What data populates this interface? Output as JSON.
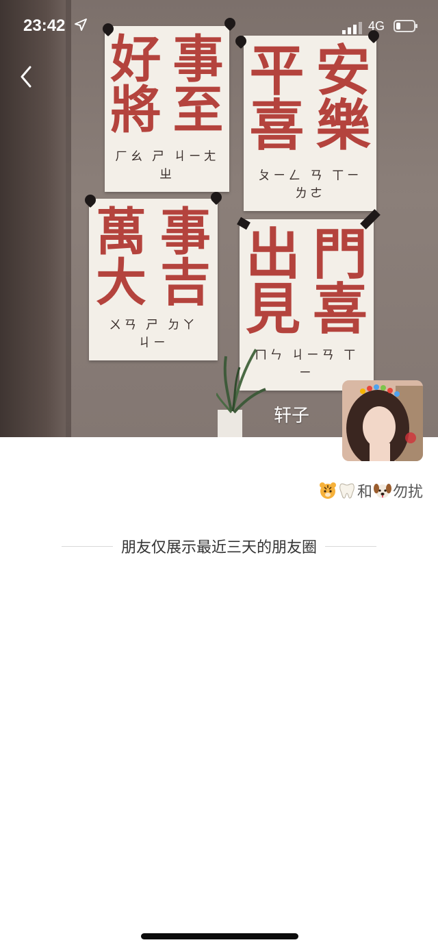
{
  "status_bar": {
    "time": "23:42",
    "network": "4G"
  },
  "cover": {
    "posters": [
      {
        "chars": [
          "好",
          "事",
          "將",
          "至"
        ],
        "zhuyin": "ㄏㄠ ㄕ ㄐㄧㄤ ㄓ"
      },
      {
        "chars": [
          "平",
          "安",
          "喜",
          "樂"
        ],
        "zhuyin": "ㄆㄧㄥ ㄢ ㄒㄧ ㄌㄜ"
      },
      {
        "chars": [
          "萬",
          "事",
          "大",
          "吉"
        ],
        "zhuyin": "ㄨㄢ ㄕ ㄉㄚ ㄐㄧ"
      },
      {
        "chars": [
          "出",
          "門",
          "見",
          "喜"
        ],
        "zhuyin": "ㄇㄣ ㄐㄧㄢ ㄒㄧ"
      }
    ]
  },
  "profile": {
    "nickname": "轩子",
    "signature_mid": "和",
    "signature_end": "勿扰"
  },
  "notice": {
    "text": "朋友仅展示最近三天的朋友圈"
  },
  "colors": {
    "poster_text": "#b4433d",
    "poster_paper": "#f3efe8"
  },
  "icons": [
    "back-arrow-icon",
    "location-arrow-icon",
    "signal-icon",
    "battery-icon",
    "tiger-emoji-icon",
    "tooth-emoji-icon",
    "dog-emoji-icon"
  ]
}
